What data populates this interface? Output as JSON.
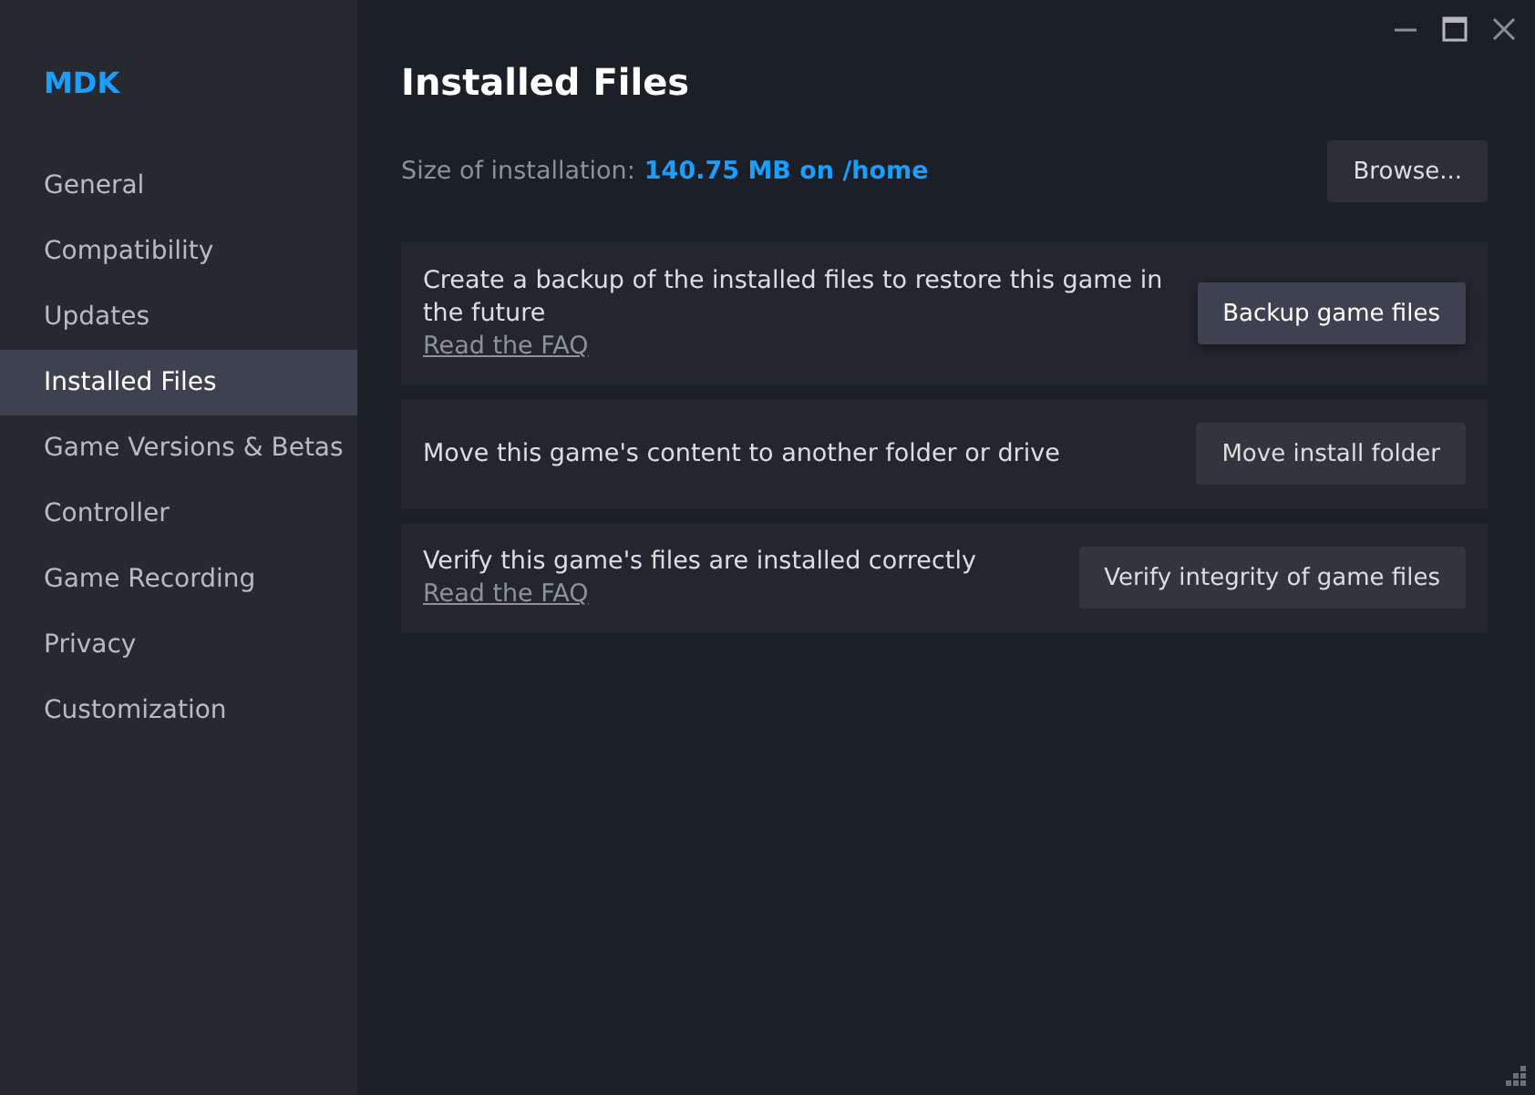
{
  "sidebar": {
    "title": "MDK",
    "items": [
      {
        "label": "General",
        "selected": false
      },
      {
        "label": "Compatibility",
        "selected": false
      },
      {
        "label": "Updates",
        "selected": false
      },
      {
        "label": "Installed Files",
        "selected": true
      },
      {
        "label": "Game Versions & Betas",
        "selected": false
      },
      {
        "label": "Controller",
        "selected": false
      },
      {
        "label": "Game Recording",
        "selected": false
      },
      {
        "label": "Privacy",
        "selected": false
      },
      {
        "label": "Customization",
        "selected": false
      }
    ]
  },
  "page": {
    "title": "Installed Files",
    "size_label": "Size of installation:",
    "size_value": "140.75 MB on /home",
    "browse_button": "Browse..."
  },
  "actions": [
    {
      "text": "Create a backup of the installed files to restore this game in the future",
      "link": "Read the FAQ",
      "button": "Backup game files",
      "focused": true
    },
    {
      "text": "Move this game's content to another folder or drive",
      "button": "Move install folder",
      "focused": false
    },
    {
      "text": "Verify this game's files are installed correctly",
      "link": "Read the FAQ",
      "button": "Verify integrity of game files",
      "focused": false
    }
  ]
}
